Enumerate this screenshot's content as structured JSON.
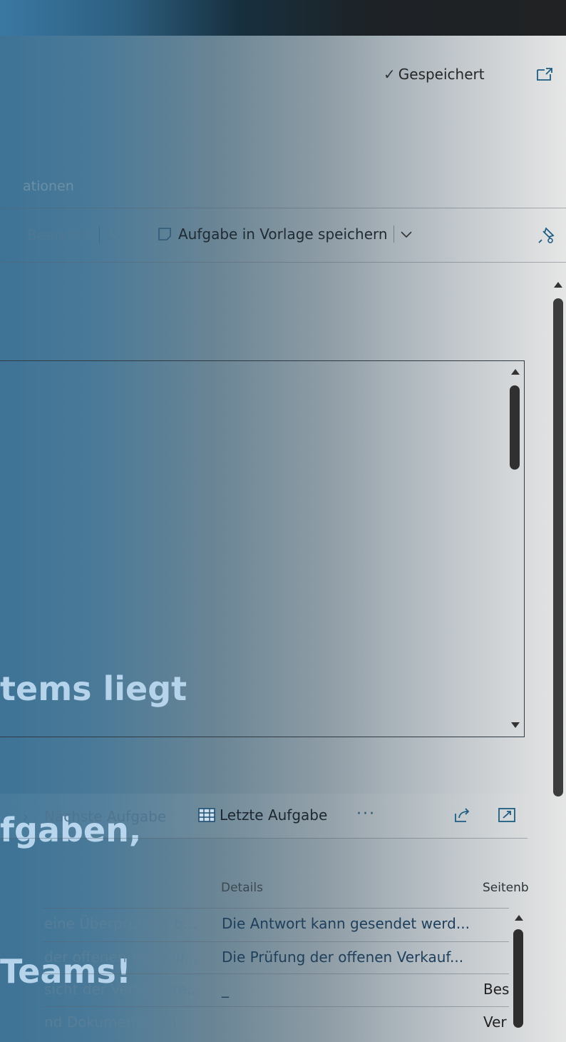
{
  "header": {
    "saved_label": "Gespeichert"
  },
  "actions": {
    "label": "ationen",
    "end_label": "Beenden",
    "save_template_label": "Aufgabe in Vorlage speichern"
  },
  "textbox": {
    "lines": [
      "tems liegt",
      "fgaben,",
      "Teams!"
    ]
  },
  "subtoolbar": {
    "next_task_label": "Nächste Aufgabe",
    "last_task_label": "Letzte Aufgabe",
    "more_label": "···"
  },
  "grid": {
    "columns": {
      "details": "Details",
      "sidebar": "Seitenb"
    },
    "rows": [
      {
        "c1": "eine Überprüfung b...",
        "c2": "Die Antwort kann gesendet werd...",
        "c3": ""
      },
      {
        "c1": "der offenen Verkauf...",
        "c2": "Die Prüfung der offenen Verkauf...",
        "c3": ""
      },
      {
        "c1": "sicht der Verkaufsre...",
        "c2": "_",
        "c3": "Bes"
      },
      {
        "c1": "nd Dokumentation",
        "c2": "",
        "c3": "Ver"
      }
    ]
  },
  "colors": {
    "accent": "#1e3f5b",
    "highlight_text": "#b5d4ec"
  },
  "icons": [
    "check-icon",
    "open-in-new-icon",
    "chevron-down-icon",
    "save-template-icon",
    "pin-icon",
    "arrow-right-icon",
    "table-icon",
    "share-icon",
    "expand-icon"
  ]
}
